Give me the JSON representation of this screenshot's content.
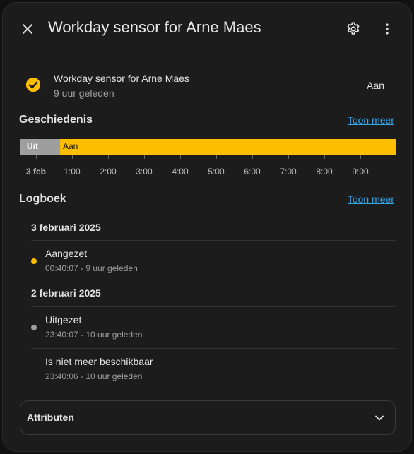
{
  "header": {
    "title": "Workday sensor for Arne Maes"
  },
  "entity": {
    "name": "Workday sensor for Arne Maes",
    "last_changed": "9 uur geleden",
    "state": "Aan",
    "icon": "check-circle-icon",
    "state_color": "#fdbe00"
  },
  "history": {
    "title": "Geschiedenis",
    "link": "Toon meer",
    "segments": [
      {
        "label": "Uit",
        "color": "#9e9e9e"
      },
      {
        "label": "Aan",
        "color": "#fdbe00"
      }
    ],
    "ticks": [
      "3 feb",
      "1:00",
      "2:00",
      "3:00",
      "4:00",
      "5:00",
      "6:00",
      "7:00",
      "8:00",
      "9:00"
    ]
  },
  "logbook": {
    "title": "Logboek",
    "link": "Toon meer",
    "groups": [
      {
        "date": "3 februari 2025",
        "entries": [
          {
            "title": "Aangezet",
            "sub": "00:40:07 - 9 uur geleden",
            "dot": "#fdbe00"
          }
        ]
      },
      {
        "date": "2 februari 2025",
        "entries": [
          {
            "title": "Uitgezet",
            "sub": "23:40:07 - 10 uur geleden",
            "dot": "#9e9e9e"
          },
          {
            "title": "Is niet meer beschikbaar",
            "sub": "23:40:06 - 10 uur geleden",
            "dot": ""
          }
        ]
      }
    ]
  },
  "attributes": {
    "label": "Attributen"
  },
  "colors": {
    "accent": "#fdbe00",
    "link": "#35a7e9",
    "background": "#1c1c1c"
  }
}
